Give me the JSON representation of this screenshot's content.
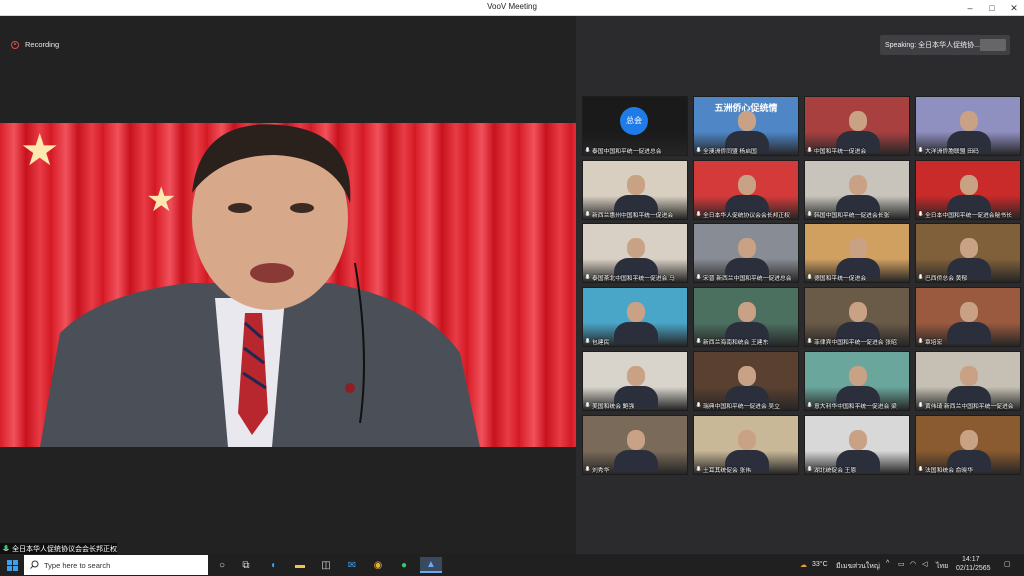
{
  "window": {
    "title": "VooV Meeting",
    "controls": [
      "–",
      "□",
      "✕"
    ]
  },
  "recording": {
    "label": "Recording",
    "color": "#e04a4a"
  },
  "main_speaker": {
    "name": "全日本华人促统协议会会长邦正权"
  },
  "speaking": {
    "label": "Speaking: 全日本华人促统协..."
  },
  "participants": [
    {
      "name": "泰国中国和平统一促进总会",
      "avatar": "总会",
      "bg": "#1a1a1a"
    },
    {
      "name": "全澳洲侨同盟 杨启国",
      "banner": "五洲侨心促统情",
      "bg": "#4e86c6"
    },
    {
      "name": "中国和平统一促进会",
      "bg": "#a84040"
    },
    {
      "name": "大洋洲侨胞联盟 田码",
      "bg": "#8f8fc0"
    },
    {
      "name": "新西兰惠州中国和平统一促进会",
      "bg": "#d8cfc0"
    },
    {
      "name": "全日本华人促统协议会会长邦正权",
      "bg": "#d43a3a"
    },
    {
      "name": "韩国中国和平统一促进会长张",
      "bg": "#c8c4bc"
    },
    {
      "name": "全日本中国和平统一促进会秘书长",
      "bg": "#c92a2a"
    },
    {
      "name": "泰国茶北中国和平统一促进会 马",
      "bg": "#d8d0c4"
    },
    {
      "name": "宋晋 新西兰中国和平统一促进总会",
      "bg": "#888c94"
    },
    {
      "name": "德国和平统一促进会",
      "bg": "#d0a060"
    },
    {
      "name": "巴西侨总会 黄郁",
      "bg": "#80603a"
    },
    {
      "name": "包建民",
      "bg": "#4aa6c8"
    },
    {
      "name": "新西兰海南和统会 王建东",
      "bg": "#4c7060"
    },
    {
      "name": "菲律宾中国和平统一促进会 张昭",
      "bg": "#6a5a48"
    },
    {
      "name": "章培宏",
      "bg": "#9a5a40"
    },
    {
      "name": "美国和统会 鲍强",
      "bg": "#d8d4cc"
    },
    {
      "name": "瑞典中国和平统一促进会 吴立",
      "bg": "#5a4030"
    },
    {
      "name": "意大利华中国和平统一促进会 梁",
      "bg": "#6aa69c"
    },
    {
      "name": "黄伟琦 新西兰中国和平统一促进会",
      "bg": "#c6c0b4"
    },
    {
      "name": "刘秀华",
      "bg": "#7a6a5a"
    },
    {
      "name": "土耳其统促会 张伟",
      "bg": "#c9b898"
    },
    {
      "name": "湖北统促会 王恩",
      "bg": "#d8d8d8"
    },
    {
      "name": "法国和统会 俞晓华",
      "bg": "#8a5a30"
    }
  ],
  "taskbar": {
    "search_placeholder": "Type here to search",
    "weather": "33°C",
    "weather_desc": "มีเมฆส่วนใหญ่",
    "lang": "ไทย",
    "time": "14:17",
    "date": "02/11/2565"
  }
}
